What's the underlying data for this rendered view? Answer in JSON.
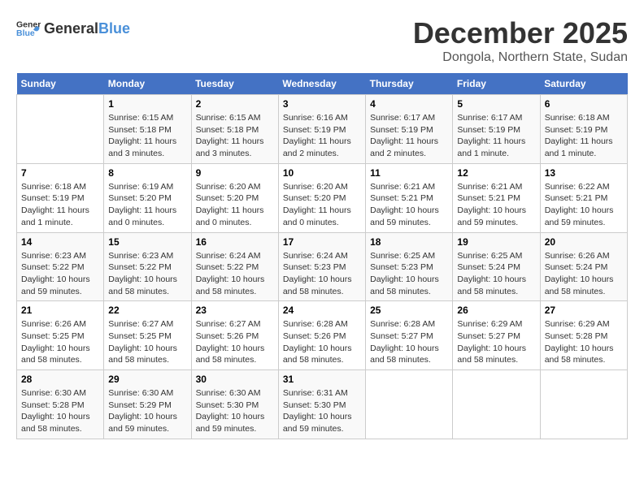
{
  "header": {
    "logo_general": "General",
    "logo_blue": "Blue",
    "title": "December 2025",
    "location": "Dongola, Northern State, Sudan"
  },
  "calendar": {
    "days_of_week": [
      "Sunday",
      "Monday",
      "Tuesday",
      "Wednesday",
      "Thursday",
      "Friday",
      "Saturday"
    ],
    "weeks": [
      [
        {
          "day": "",
          "info": ""
        },
        {
          "day": "1",
          "info": "Sunrise: 6:15 AM\nSunset: 5:18 PM\nDaylight: 11 hours and 3 minutes."
        },
        {
          "day": "2",
          "info": "Sunrise: 6:15 AM\nSunset: 5:18 PM\nDaylight: 11 hours and 3 minutes."
        },
        {
          "day": "3",
          "info": "Sunrise: 6:16 AM\nSunset: 5:19 PM\nDaylight: 11 hours and 2 minutes."
        },
        {
          "day": "4",
          "info": "Sunrise: 6:17 AM\nSunset: 5:19 PM\nDaylight: 11 hours and 2 minutes."
        },
        {
          "day": "5",
          "info": "Sunrise: 6:17 AM\nSunset: 5:19 PM\nDaylight: 11 hours and 1 minute."
        },
        {
          "day": "6",
          "info": "Sunrise: 6:18 AM\nSunset: 5:19 PM\nDaylight: 11 hours and 1 minute."
        }
      ],
      [
        {
          "day": "7",
          "info": "Sunrise: 6:18 AM\nSunset: 5:19 PM\nDaylight: 11 hours and 1 minute."
        },
        {
          "day": "8",
          "info": "Sunrise: 6:19 AM\nSunset: 5:20 PM\nDaylight: 11 hours and 0 minutes."
        },
        {
          "day": "9",
          "info": "Sunrise: 6:20 AM\nSunset: 5:20 PM\nDaylight: 11 hours and 0 minutes."
        },
        {
          "day": "10",
          "info": "Sunrise: 6:20 AM\nSunset: 5:20 PM\nDaylight: 11 hours and 0 minutes."
        },
        {
          "day": "11",
          "info": "Sunrise: 6:21 AM\nSunset: 5:21 PM\nDaylight: 10 hours and 59 minutes."
        },
        {
          "day": "12",
          "info": "Sunrise: 6:21 AM\nSunset: 5:21 PM\nDaylight: 10 hours and 59 minutes."
        },
        {
          "day": "13",
          "info": "Sunrise: 6:22 AM\nSunset: 5:21 PM\nDaylight: 10 hours and 59 minutes."
        }
      ],
      [
        {
          "day": "14",
          "info": "Sunrise: 6:23 AM\nSunset: 5:22 PM\nDaylight: 10 hours and 59 minutes."
        },
        {
          "day": "15",
          "info": "Sunrise: 6:23 AM\nSunset: 5:22 PM\nDaylight: 10 hours and 58 minutes."
        },
        {
          "day": "16",
          "info": "Sunrise: 6:24 AM\nSunset: 5:22 PM\nDaylight: 10 hours and 58 minutes."
        },
        {
          "day": "17",
          "info": "Sunrise: 6:24 AM\nSunset: 5:23 PM\nDaylight: 10 hours and 58 minutes."
        },
        {
          "day": "18",
          "info": "Sunrise: 6:25 AM\nSunset: 5:23 PM\nDaylight: 10 hours and 58 minutes."
        },
        {
          "day": "19",
          "info": "Sunrise: 6:25 AM\nSunset: 5:24 PM\nDaylight: 10 hours and 58 minutes."
        },
        {
          "day": "20",
          "info": "Sunrise: 6:26 AM\nSunset: 5:24 PM\nDaylight: 10 hours and 58 minutes."
        }
      ],
      [
        {
          "day": "21",
          "info": "Sunrise: 6:26 AM\nSunset: 5:25 PM\nDaylight: 10 hours and 58 minutes."
        },
        {
          "day": "22",
          "info": "Sunrise: 6:27 AM\nSunset: 5:25 PM\nDaylight: 10 hours and 58 minutes."
        },
        {
          "day": "23",
          "info": "Sunrise: 6:27 AM\nSunset: 5:26 PM\nDaylight: 10 hours and 58 minutes."
        },
        {
          "day": "24",
          "info": "Sunrise: 6:28 AM\nSunset: 5:26 PM\nDaylight: 10 hours and 58 minutes."
        },
        {
          "day": "25",
          "info": "Sunrise: 6:28 AM\nSunset: 5:27 PM\nDaylight: 10 hours and 58 minutes."
        },
        {
          "day": "26",
          "info": "Sunrise: 6:29 AM\nSunset: 5:27 PM\nDaylight: 10 hours and 58 minutes."
        },
        {
          "day": "27",
          "info": "Sunrise: 6:29 AM\nSunset: 5:28 PM\nDaylight: 10 hours and 58 minutes."
        }
      ],
      [
        {
          "day": "28",
          "info": "Sunrise: 6:30 AM\nSunset: 5:28 PM\nDaylight: 10 hours and 58 minutes."
        },
        {
          "day": "29",
          "info": "Sunrise: 6:30 AM\nSunset: 5:29 PM\nDaylight: 10 hours and 59 minutes."
        },
        {
          "day": "30",
          "info": "Sunrise: 6:30 AM\nSunset: 5:30 PM\nDaylight: 10 hours and 59 minutes."
        },
        {
          "day": "31",
          "info": "Sunrise: 6:31 AM\nSunset: 5:30 PM\nDaylight: 10 hours and 59 minutes."
        },
        {
          "day": "",
          "info": ""
        },
        {
          "day": "",
          "info": ""
        },
        {
          "day": "",
          "info": ""
        }
      ]
    ]
  }
}
